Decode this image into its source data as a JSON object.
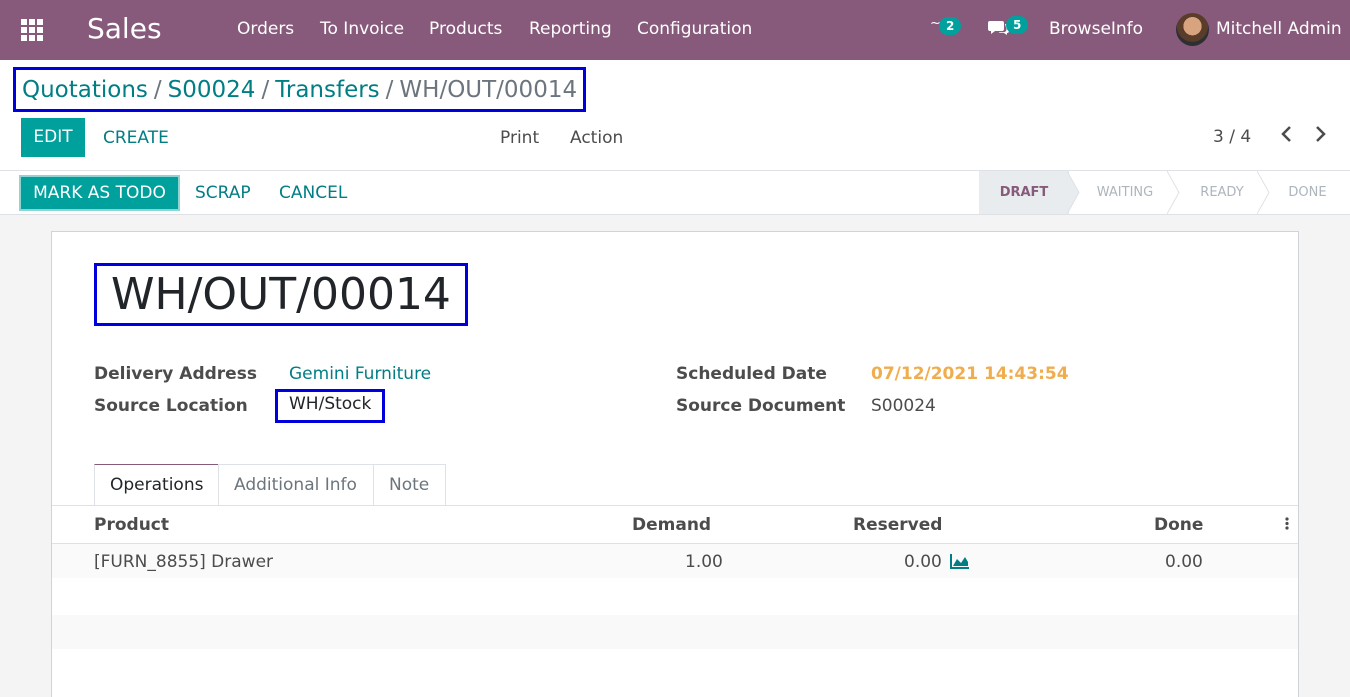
{
  "navbar": {
    "app_name": "Sales",
    "menu": [
      "Orders",
      "To Invoice",
      "Products",
      "Reporting",
      "Configuration"
    ],
    "activity_badge": "2",
    "messages_badge": "5",
    "company": "BrowseInfo",
    "user": "Mitchell Admin"
  },
  "breadcrumb": {
    "items": [
      "Quotations",
      "S00024",
      "Transfers"
    ],
    "current": "WH/OUT/00014",
    "separator": "/"
  },
  "control": {
    "edit_label": "EDIT",
    "create_label": "CREATE",
    "print_label": "Print",
    "action_label": "Action",
    "pager": "3 / 4"
  },
  "statusbar": {
    "todo_label": "MARK AS TODO",
    "scrap_label": "SCRAP",
    "cancel_label": "CANCEL",
    "stages": [
      "DRAFT",
      "WAITING",
      "READY",
      "DONE"
    ],
    "active_stage": "DRAFT"
  },
  "record": {
    "title": "WH/OUT/00014",
    "delivery_address_label": "Delivery Address",
    "delivery_address": "Gemini Furniture",
    "source_location_label": "Source Location",
    "source_location": "WH/Stock",
    "scheduled_date_label": "Scheduled Date",
    "scheduled_date": "07/12/2021 14:43:54",
    "source_document_label": "Source Document",
    "source_document": "S00024"
  },
  "tabs": [
    "Operations",
    "Additional Info",
    "Note"
  ],
  "table": {
    "headers": [
      "Product",
      "Demand",
      "Reserved",
      "Done"
    ],
    "rows": [
      {
        "product": "[FURN_8855] Drawer",
        "demand": "1.00",
        "reserved": "0.00",
        "done": "0.00"
      }
    ]
  },
  "colors": {
    "brand": "#875a7b",
    "accent": "#00a09d",
    "link": "#017e84",
    "warning": "#f0ad4e",
    "highlight_box": "#0000dd"
  }
}
